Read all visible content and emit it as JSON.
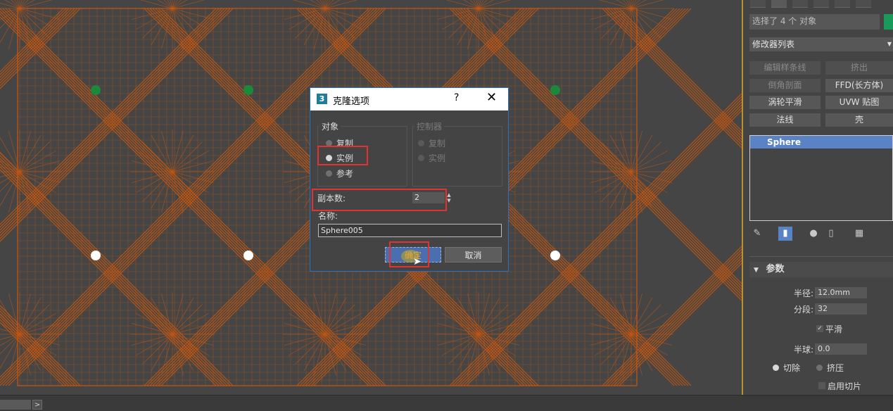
{
  "dialog": {
    "app_icon": "3",
    "title": "克隆选项",
    "help": "?",
    "close": "✕",
    "object_group": {
      "title": "对象",
      "options": [
        "复制",
        "实例",
        "参考"
      ],
      "selected": "实例"
    },
    "controller_group": {
      "title": "控制器",
      "options": [
        "复制",
        "实例"
      ]
    },
    "copies_label": "副本数:",
    "copies_value": "2",
    "name_label": "名称:",
    "name_value": "Sphere005",
    "ok_label": "确定",
    "cancel_label": "取消"
  },
  "panel": {
    "selection_text": "选择了 4 个 对象",
    "modifier_list": "修改器列表",
    "modifier_buttons": [
      {
        "label": "编辑样条线",
        "enabled": false
      },
      {
        "label": "挤出",
        "enabled": false
      },
      {
        "label": "倒角剖面",
        "enabled": false
      },
      {
        "label": "FFD(长方体)",
        "enabled": true
      },
      {
        "label": "涡轮平滑",
        "enabled": true
      },
      {
        "label": "UVW 贴图",
        "enabled": true
      },
      {
        "label": "法线",
        "enabled": true
      },
      {
        "label": "壳",
        "enabled": true
      }
    ],
    "stack_item": "Sphere",
    "params_title": "参数",
    "radius_label": "半径:",
    "radius_value": "12.0mm",
    "segments_label": "分段:",
    "segments_value": "32",
    "smooth_label": "平滑",
    "hemisphere_label": "半球:",
    "hemisphere_value": "0.0",
    "chop_label": "切除",
    "squash_label": "挤压",
    "slice_label": "启用切片"
  },
  "colors": {
    "wireframe": "#c8570f",
    "selected_vertex": "#1a8a3a",
    "vertex": "#ffffff",
    "accent_border": "#e23333",
    "viewport_border": "#b9922e"
  }
}
